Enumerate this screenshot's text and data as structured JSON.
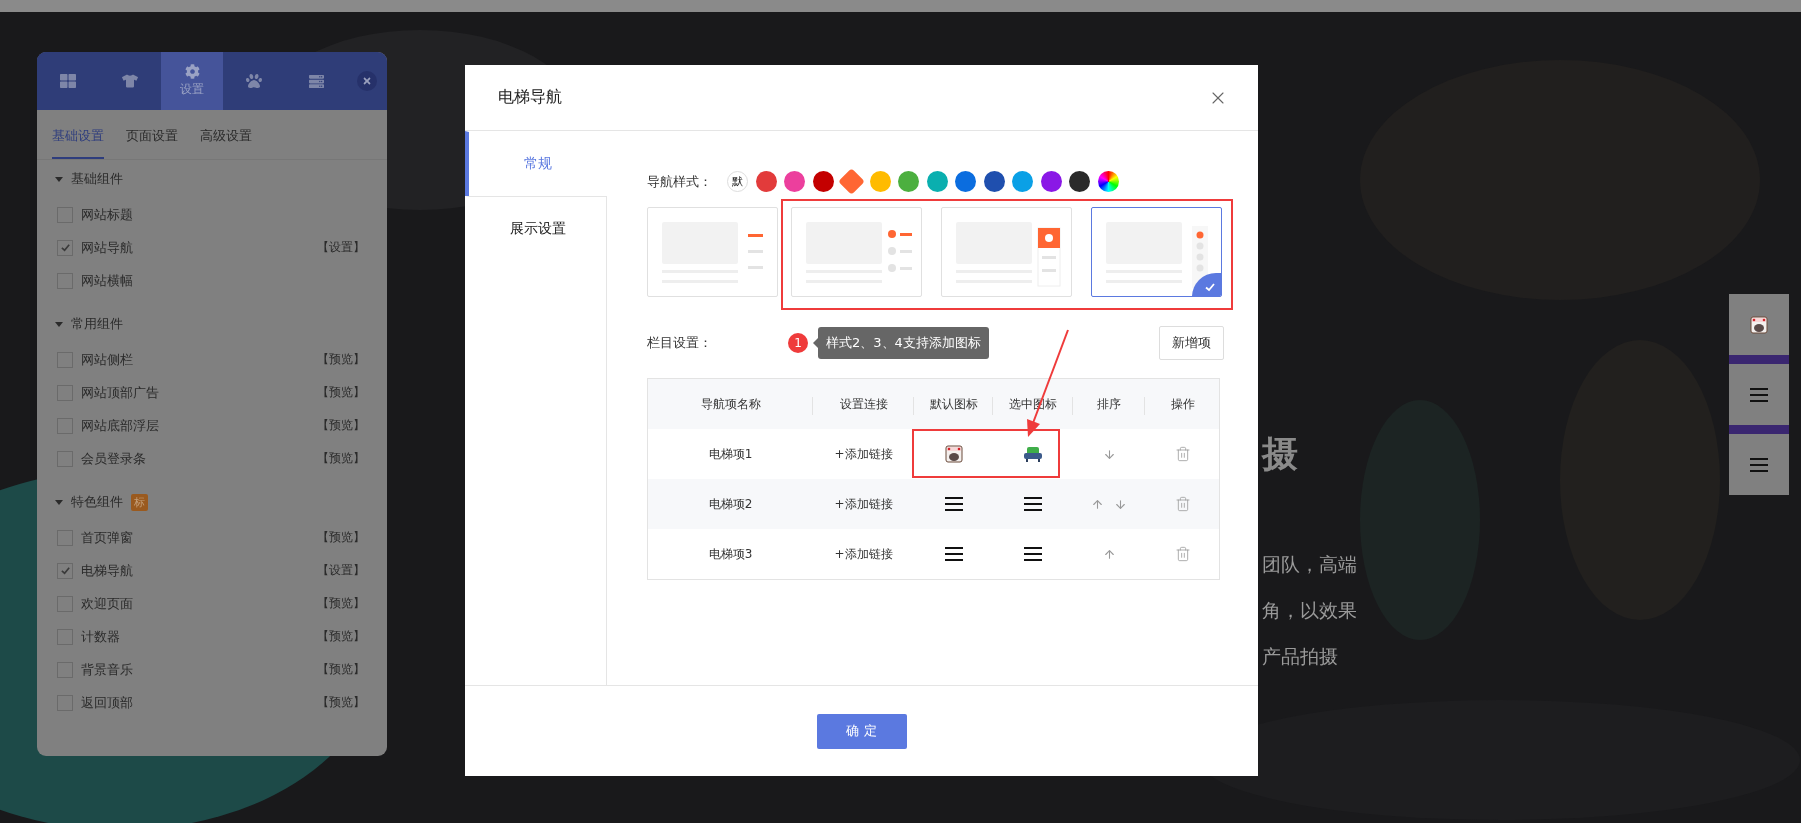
{
  "editor_panel": {
    "toolbar": [
      {
        "kind": "grid",
        "selected": false
      },
      {
        "kind": "shirt",
        "selected": false
      },
      {
        "kind": "gear",
        "label": "设置",
        "selected": true
      },
      {
        "kind": "paw",
        "selected": false
      },
      {
        "kind": "stand",
        "selected": false
      }
    ],
    "tabs": [
      {
        "label": "基础设置",
        "selected": true
      },
      {
        "label": "页面设置",
        "selected": false
      },
      {
        "label": "高级设置",
        "selected": false
      }
    ],
    "groups": [
      {
        "title": "基础组件",
        "expanded": true,
        "items": [
          {
            "label": "网站标题",
            "checked": false
          },
          {
            "label": "网站导航",
            "checked": true,
            "action": "【设置】"
          },
          {
            "label": "网站横幅",
            "checked": false
          }
        ]
      },
      {
        "title": "常用组件",
        "expanded": true,
        "items": [
          {
            "label": "网站侧栏",
            "checked": false,
            "action": "【预览】"
          },
          {
            "label": "网站顶部广告",
            "checked": false,
            "action": "【预览】"
          },
          {
            "label": "网站底部浮层",
            "checked": false,
            "action": "【预览】"
          },
          {
            "label": "会员登录条",
            "checked": false,
            "action": "【预览】"
          }
        ]
      },
      {
        "title": "特色组件",
        "badge": "标",
        "expanded": true,
        "items": [
          {
            "label": "首页弹窗",
            "checked": false,
            "action": "【预览】"
          },
          {
            "label": "电梯导航",
            "checked": true,
            "action": "【设置】"
          },
          {
            "label": "欢迎页面",
            "checked": false,
            "action": "【预览】"
          },
          {
            "label": "计数器",
            "checked": false,
            "action": "【预览】"
          },
          {
            "label": "背景音乐",
            "checked": false,
            "action": "【预览】"
          },
          {
            "label": "返回顶部",
            "checked": false,
            "action": "【预览】"
          }
        ]
      }
    ]
  },
  "background_page": {
    "heading": "摄",
    "lines": [
      "团队，高端",
      "角，以效果",
      "产品拍摄"
    ]
  },
  "modal": {
    "title": "电梯导航",
    "side_tabs": [
      {
        "label": "常规",
        "selected": true
      },
      {
        "label": "展示设置",
        "selected": false
      }
    ],
    "style_label": "导航样式：",
    "swatches": [
      {
        "kind": "default",
        "label": "默",
        "selected": false
      },
      {
        "kind": "color",
        "color": "#e23b3b",
        "selected": false
      },
      {
        "kind": "color",
        "color": "#ec3f9d",
        "selected": false
      },
      {
        "kind": "color",
        "color": "#c40000",
        "selected": false
      },
      {
        "kind": "color",
        "color": "#ff6633",
        "selected": true
      },
      {
        "kind": "color",
        "color": "#ffbb00",
        "selected": false
      },
      {
        "kind": "color",
        "color": "#4caf3f",
        "selected": false
      },
      {
        "kind": "color",
        "color": "#0aafaf",
        "selected": false
      },
      {
        "kind": "color",
        "color": "#0b6ddf",
        "selected": false
      },
      {
        "kind": "color",
        "color": "#1f4fae",
        "selected": false
      },
      {
        "kind": "color",
        "color": "#0aa0e6",
        "selected": false
      },
      {
        "kind": "color",
        "color": "#8a18e6",
        "selected": false
      },
      {
        "kind": "color",
        "color": "#2a2a2a",
        "selected": false
      },
      {
        "kind": "custom",
        "selected": false
      }
    ],
    "style_card_groups": [
      {
        "highlighted": false,
        "cards": [
          {
            "kind": "bars",
            "selected": false
          }
        ]
      },
      {
        "highlighted": true,
        "cards": [
          {
            "kind": "dots",
            "selected": false
          },
          {
            "kind": "block",
            "selected": false
          },
          {
            "kind": "column",
            "selected": true
          }
        ]
      }
    ],
    "columns_label": "栏目设置：",
    "tooltip": {
      "number": "1",
      "text": "样式2、3、4支持添加图标"
    },
    "add_button": "新增项",
    "table": {
      "columns": [
        "导航项名称",
        "设置连接",
        "默认图标",
        "选中图标",
        "排序",
        "操作"
      ],
      "rows": [
        {
          "name": "电梯项1",
          "link": "+添加链接",
          "default_icon": {
            "kind": "sticker"
          },
          "selected_icon": {
            "kind": "sofa"
          },
          "up": false,
          "down": true,
          "highlighted": true
        },
        {
          "name": "电梯项2",
          "link": "+添加链接",
          "default_icon": {
            "kind": "menu"
          },
          "selected_icon": {
            "kind": "menu"
          },
          "up": true,
          "down": true,
          "highlighted": false
        },
        {
          "name": "电梯项3",
          "link": "+添加链接",
          "default_icon": {
            "kind": "menu"
          },
          "selected_icon": {
            "kind": "menu"
          },
          "up": true,
          "down": false,
          "highlighted": false
        }
      ]
    },
    "confirm_button": "确 定"
  },
  "floating_nav": [
    {
      "kind": "sticker"
    },
    {
      "kind": "menu"
    },
    {
      "kind": "menu"
    }
  ]
}
